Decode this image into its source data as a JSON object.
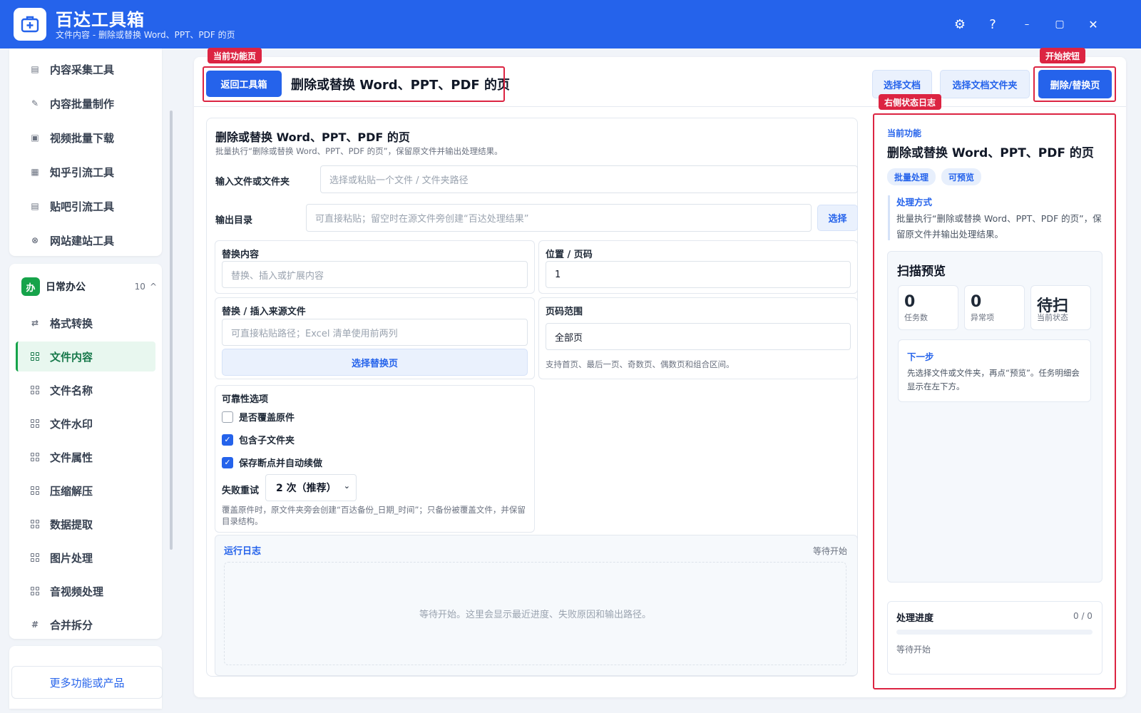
{
  "app": {
    "name": "百达工具箱",
    "subtitle": "文件内容 - 删除或替换 Word、PPT、PDF 的页"
  },
  "window_controls": {
    "settings": "⚙",
    "help": "?",
    "minimize": "–",
    "maximize": "▢",
    "close": "✕"
  },
  "sidebar": {
    "group1_items": [
      {
        "label": "内容采集工具",
        "icon": "doc-icon"
      },
      {
        "label": "内容批量制作",
        "icon": "pen-icon"
      },
      {
        "label": "视频批量下载",
        "icon": "video-icon"
      },
      {
        "label": "知乎引流工具",
        "icon": "zhihu-icon"
      },
      {
        "label": "贴吧引流工具",
        "icon": "tieba-icon"
      },
      {
        "label": "网站建站工具",
        "icon": "site-icon"
      }
    ],
    "group2": {
      "badge": "办",
      "title": "日常办公",
      "count": "10",
      "caret": "^"
    },
    "group2_items": [
      {
        "label": "格式转换",
        "icon": "swap-icon"
      },
      {
        "label": "文件内容",
        "icon": "grid-icon"
      },
      {
        "label": "文件名称",
        "icon": "grid-icon"
      },
      {
        "label": "文件水印",
        "icon": "grid-icon"
      },
      {
        "label": "文件属性",
        "icon": "grid-icon"
      },
      {
        "label": "压缩解压",
        "icon": "grid-icon"
      },
      {
        "label": "数据提取",
        "icon": "grid-icon"
      },
      {
        "label": "图片处理",
        "icon": "grid-icon"
      },
      {
        "label": "音视频处理",
        "icon": "grid-icon"
      },
      {
        "label": "合并拆分",
        "icon": "hash-icon"
      }
    ],
    "more": "更多功能或产品"
  },
  "toolbar": {
    "back": "返回工具箱",
    "title": "删除或替换 Word、PPT、PDF 的页",
    "choose_doc": "选择文档",
    "choose_folder": "选择文档文件夹",
    "start": "删除/替换页"
  },
  "annotations": {
    "current_page": "当前功能页",
    "start_button": "开始按钮",
    "right_log": "右侧状态日志"
  },
  "form": {
    "heading": "删除或替换 Word、PPT、PDF 的页",
    "desc": "批量执行“删除或替换 Word、PPT、PDF 的页”，保留原文件并输出处理结果。",
    "input_label": "输入文件或文件夹",
    "input_placeholder": "选择或粘贴一个文件 / 文件夹路径",
    "output_label": "输出目录",
    "output_placeholder": "可直接粘贴；留空时在源文件旁创建“百达处理结果”",
    "output_btn": "选择",
    "replace_label": "替换内容",
    "replace_placeholder": "替换、插入或扩展内容",
    "position_label": "位置 / 页码",
    "position_value": "1",
    "source_label": "替换 / 插入来源文件",
    "source_placeholder": "可直接粘贴路径；Excel 清单使用前两列",
    "source_btn": "选择替换页",
    "range_label": "页码范围",
    "range_value": "全部页",
    "range_hint": "支持首页、最后一页、奇数页、偶数页和组合区间。",
    "reliability_label": "可靠性选项",
    "opt_overwrite": "是否覆盖原件",
    "opt_subfolders": "包含子文件夹",
    "opt_resume": "保存断点并自动续做",
    "retry_label": "失败重试",
    "retry_value": "2 次（推荐）",
    "reliability_hint": "覆盖原件时，原文件夹旁会创建“百达备份_日期_时间”；只备份被覆盖文件，并保留目录结构。",
    "log_title": "运行日志",
    "log_status": "等待开始",
    "log_placeholder": "等待开始。这里会显示最近进度、失败原因和输出路径。"
  },
  "right_panel": {
    "current_label": "当前功能",
    "title": "删除或替换 Word、PPT、PDF 的页",
    "chips": [
      "批量处理",
      "可预览"
    ],
    "method_title": "处理方式",
    "method_text": "批量执行“删除或替换 Word、PPT、PDF 的页”，保留原文件并输出处理结果。",
    "scan_title": "扫描预览",
    "stats": [
      {
        "value": "0",
        "label": "任务数"
      },
      {
        "value": "0",
        "label": "异常项"
      },
      {
        "value": "待扫",
        "label": "当前状态"
      }
    ],
    "next_title": "下一步",
    "next_text": "先选择文件或文件夹，再点“预览”。任务明细会显示在左下方。",
    "progress_title": "处理进度",
    "progress_count": "0 / 0",
    "progress_fraction": 0,
    "progress_status": "等待开始"
  }
}
